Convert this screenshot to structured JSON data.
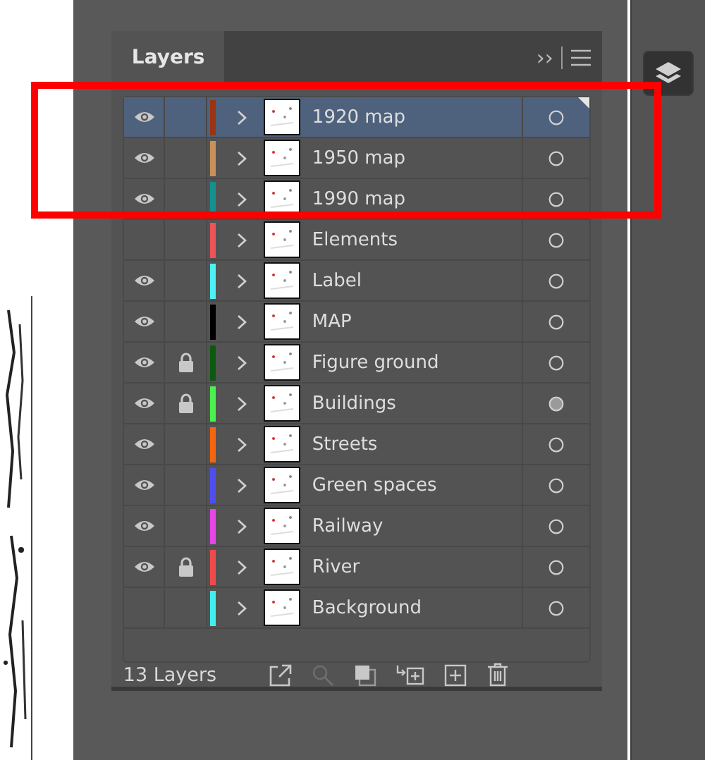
{
  "panel": {
    "title": "Layers",
    "collapse_icon": "››"
  },
  "highlight": {
    "shown": true
  },
  "layers": [
    {
      "name": "1920 map",
      "visible": true,
      "locked": false,
      "color": "#9a3412",
      "selected": true,
      "target_filled": false
    },
    {
      "name": "1950 map",
      "visible": true,
      "locked": false,
      "color": "#c8915a",
      "selected": false,
      "target_filled": false
    },
    {
      "name": "1990 map",
      "visible": true,
      "locked": false,
      "color": "#12918f",
      "selected": false,
      "target_filled": false
    },
    {
      "name": "Elements",
      "visible": false,
      "locked": false,
      "color": "#f0525a",
      "selected": false,
      "target_filled": false
    },
    {
      "name": "Label",
      "visible": true,
      "locked": false,
      "color": "#4ef0f5",
      "selected": false,
      "target_filled": false
    },
    {
      "name": "MAP",
      "visible": true,
      "locked": false,
      "color": "#000000",
      "selected": false,
      "target_filled": false
    },
    {
      "name": "Figure ground",
      "visible": true,
      "locked": true,
      "color": "#0b5a10",
      "selected": false,
      "target_filled": false
    },
    {
      "name": "Buildings",
      "visible": true,
      "locked": true,
      "color": "#4cf04c",
      "selected": false,
      "target_filled": true
    },
    {
      "name": "Streets",
      "visible": true,
      "locked": false,
      "color": "#f5650f",
      "selected": false,
      "target_filled": false
    },
    {
      "name": "Green spaces",
      "visible": true,
      "locked": false,
      "color": "#4f4ff0",
      "selected": false,
      "target_filled": false
    },
    {
      "name": "Railway",
      "visible": true,
      "locked": false,
      "color": "#e845e8",
      "selected": false,
      "target_filled": false
    },
    {
      "name": "River",
      "visible": true,
      "locked": true,
      "color": "#ef4a4a",
      "selected": false,
      "target_filled": false
    },
    {
      "name": "Background",
      "visible": false,
      "locked": false,
      "color": "#40f0f0",
      "selected": false,
      "target_filled": false
    }
  ],
  "footer": {
    "count": "13 Layers"
  }
}
